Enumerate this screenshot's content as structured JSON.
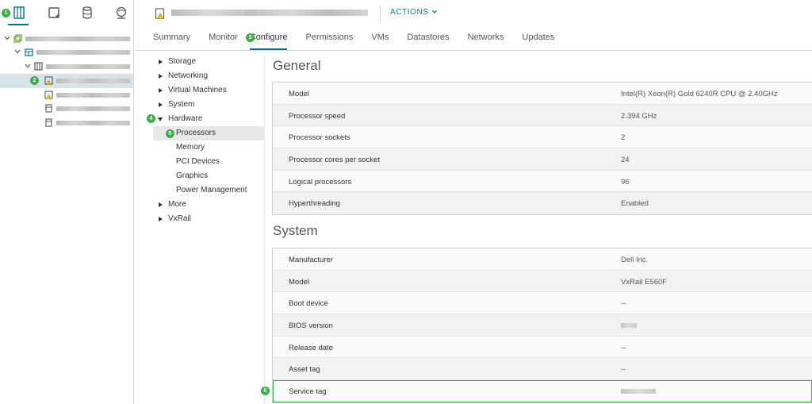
{
  "header": {
    "actions_label": "ACTIONS",
    "tabs": [
      "Summary",
      "Monitor",
      "Configure",
      "Permissions",
      "VMs",
      "Datastores",
      "Networks",
      "Updates"
    ],
    "active_tab": "Configure"
  },
  "badges": [
    "1",
    "2",
    "3",
    "4",
    "5",
    "6"
  ],
  "config_menu": {
    "storage": "Storage",
    "networking": "Networking",
    "virtual_machines": "Virtual Machines",
    "system": "System",
    "hardware": "Hardware",
    "processors": "Processors",
    "memory": "Memory",
    "pci_devices": "PCI Devices",
    "graphics": "Graphics",
    "power_management": "Power Management",
    "more": "More",
    "vxrail": "VxRail"
  },
  "general": {
    "title": "General",
    "rows": [
      {
        "key": "Model",
        "value": "Intel(R) Xeon(R) Gold 6240R CPU @ 2.40GHz"
      },
      {
        "key": "Processor speed",
        "value": "2.394 GHz"
      },
      {
        "key": "Processor sockets",
        "value": "2"
      },
      {
        "key": "Processor cores per socket",
        "value": "24"
      },
      {
        "key": "Logical processors",
        "value": "96"
      },
      {
        "key": "Hyperthreading",
        "value": "Enabled"
      }
    ]
  },
  "system": {
    "title": "System",
    "rows": [
      {
        "key": "Manufacturer",
        "value": "Dell Inc."
      },
      {
        "key": "Model",
        "value": "VxRail E560F"
      },
      {
        "key": "Boot device",
        "value": "--"
      },
      {
        "key": "BIOS version",
        "value": ""
      },
      {
        "key": "Release date",
        "value": "--"
      },
      {
        "key": "Asset tag",
        "value": "--"
      },
      {
        "key": "Service tag",
        "value": ""
      }
    ]
  },
  "colors": {
    "accent": "#0072a3",
    "link": "#0079b8",
    "badge": "#3fae49",
    "warning": "#f5c000"
  },
  "icons": [
    "hosts-clusters-icon",
    "vms-templates-icon",
    "storage-icon",
    "networking-icon",
    "warning-icon",
    "host-icon",
    "datacenter-icon",
    "cluster-icon",
    "vcenter-icon"
  ]
}
